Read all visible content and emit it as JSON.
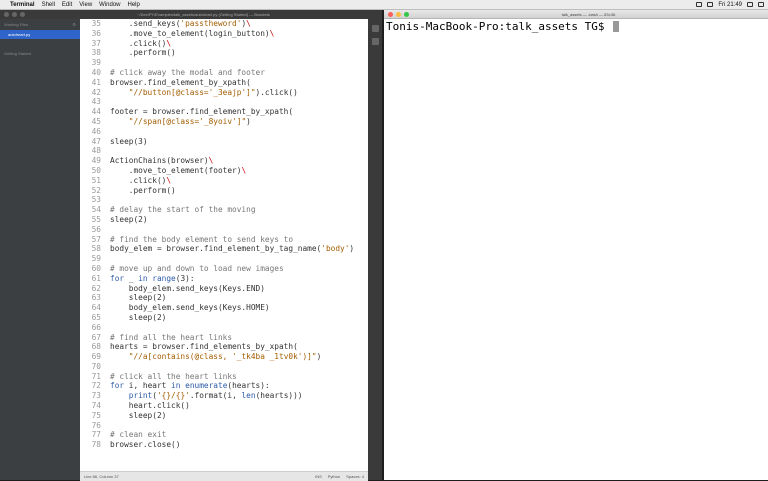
{
  "menubar": {
    "items": [
      "Terminal",
      "Shell",
      "Edit",
      "View",
      "Window",
      "Help"
    ],
    "clock": "Fri 21:49"
  },
  "editor": {
    "title": "~/Dev/PY/Examples/talk_assets/autoheart.py (Getting Started) — Brackets",
    "sidebar": {
      "working_files_label": "Working Files",
      "active_file": "autoheart.py",
      "project_label": "Getting Started"
    },
    "status": {
      "position": "Line 86, Column 37",
      "mode": "INS",
      "language": "Python",
      "spaces": "Spaces: 4"
    },
    "lines": [
      {
        "n": "35",
        "text": "    .send_keys('passtheword')\\"
      },
      {
        "n": "36",
        "text": "    .move_to_element(login_button)\\"
      },
      {
        "n": "37",
        "text": "    .click()\\"
      },
      {
        "n": "38",
        "text": "    .perform()"
      },
      {
        "n": "39",
        "text": ""
      },
      {
        "n": "40",
        "text": "# click away the modal and footer"
      },
      {
        "n": "41",
        "text": "browser.find_element_by_xpath("
      },
      {
        "n": "42",
        "text": "    \"//button[@class='_3eajp']\").click()"
      },
      {
        "n": "43",
        "text": ""
      },
      {
        "n": "44",
        "text": "footer = browser.find_element_by_xpath("
      },
      {
        "n": "45",
        "text": "    \"//span[@class='_8yoiv']\")"
      },
      {
        "n": "46",
        "text": ""
      },
      {
        "n": "47",
        "text": "sleep(3)"
      },
      {
        "n": "48",
        "text": ""
      },
      {
        "n": "49",
        "text": "ActionChains(browser)\\"
      },
      {
        "n": "50",
        "text": "    .move_to_element(footer)\\"
      },
      {
        "n": "51",
        "text": "    .click()\\"
      },
      {
        "n": "52",
        "text": "    .perform()"
      },
      {
        "n": "53",
        "text": ""
      },
      {
        "n": "54",
        "text": "# delay the start of the moving"
      },
      {
        "n": "55",
        "text": "sleep(2)"
      },
      {
        "n": "56",
        "text": ""
      },
      {
        "n": "57",
        "text": "# find the body element to send keys to"
      },
      {
        "n": "58",
        "text": "body_elem = browser.find_element_by_tag_name('body')"
      },
      {
        "n": "59",
        "text": ""
      },
      {
        "n": "60",
        "text": "# move up and down to load new images"
      },
      {
        "n": "61",
        "text": "for _ in range(3):"
      },
      {
        "n": "62",
        "text": "    body_elem.send_keys(Keys.END)"
      },
      {
        "n": "63",
        "text": "    sleep(2)"
      },
      {
        "n": "64",
        "text": "    body_elem.send_keys(Keys.HOME)"
      },
      {
        "n": "65",
        "text": "    sleep(2)"
      },
      {
        "n": "66",
        "text": ""
      },
      {
        "n": "67",
        "text": "# find all the heart links"
      },
      {
        "n": "68",
        "text": "hearts = browser.find_elements_by_xpath("
      },
      {
        "n": "69",
        "text": "    \"//a[contains(@class, '_tk4ba _1tv0k')]\")"
      },
      {
        "n": "70",
        "text": ""
      },
      {
        "n": "71",
        "text": "# click all the heart links"
      },
      {
        "n": "72",
        "text": "for i, heart in enumerate(hearts):"
      },
      {
        "n": "73",
        "text": "    print('{}/{}'.format(i, len(hearts)))"
      },
      {
        "n": "74",
        "text": "    heart.click()"
      },
      {
        "n": "75",
        "text": "    sleep(2)"
      },
      {
        "n": "76",
        "text": ""
      },
      {
        "n": "77",
        "text": "# clean exit"
      },
      {
        "n": "78",
        "text": "browser.close()"
      }
    ]
  },
  "terminal": {
    "title": "talk_assets — -bash — 63×36",
    "prompt": "Tonis-MacBook-Pro:talk_assets TG$ "
  },
  "colors": {
    "editor_bg": "#ffffff",
    "sidebar_bg": "#3c3f41",
    "comment": "#777777",
    "string": "#a35c00",
    "keyword": "#2c5aa8",
    "terminal_bg": "#ffffff"
  }
}
